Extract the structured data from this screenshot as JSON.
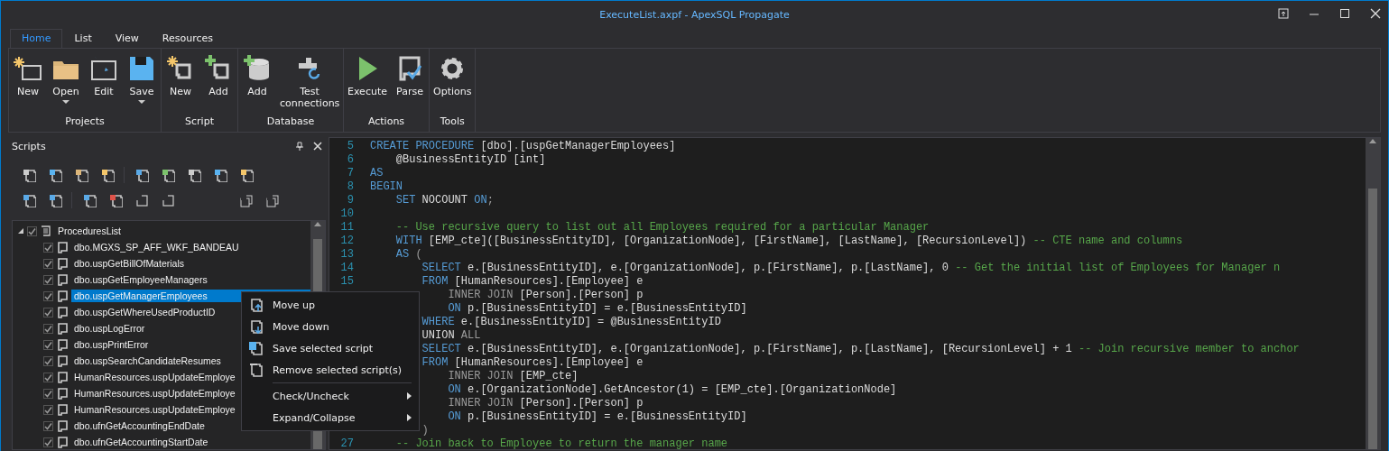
{
  "window": {
    "title": "ExecuteList.axpf - ApexSQL Propagate"
  },
  "ribbon": {
    "tabs": [
      {
        "label": "Home",
        "selected": true
      },
      {
        "label": "List",
        "selected": false
      },
      {
        "label": "View",
        "selected": false
      },
      {
        "label": "Resources",
        "selected": false
      }
    ],
    "groups": [
      {
        "label": "Projects",
        "buttons": [
          {
            "label": "New",
            "dropdown": false
          },
          {
            "label": "Open",
            "dropdown": true
          },
          {
            "label": "Edit",
            "dropdown": false
          },
          {
            "label": "Save",
            "dropdown": true
          }
        ]
      },
      {
        "label": "Script",
        "buttons": [
          {
            "label": "New",
            "dropdown": false
          },
          {
            "label": "Add",
            "dropdown": false
          }
        ]
      },
      {
        "label": "Database",
        "buttons": [
          {
            "label": "Add",
            "dropdown": false
          },
          {
            "label": "Test connections",
            "dropdown": false
          }
        ]
      },
      {
        "label": "Actions",
        "buttons": [
          {
            "label": "Execute",
            "dropdown": false
          },
          {
            "label": "Parse",
            "dropdown": false
          }
        ]
      },
      {
        "label": "Tools",
        "buttons": [
          {
            "label": "Options",
            "dropdown": false
          }
        ]
      }
    ]
  },
  "scripts_panel": {
    "title": "Scripts",
    "tree": [
      {
        "label": "ProceduresList",
        "checked": true,
        "expanded": true,
        "selected": false,
        "children": [
          {
            "label": "dbo.MGXS_SP_AFF_WKF_BANDEAU",
            "checked": true,
            "selected": false
          },
          {
            "label": "dbo.uspGetBillOfMaterials",
            "checked": true,
            "selected": false
          },
          {
            "label": "dbo.uspGetEmployeeManagers",
            "checked": true,
            "selected": false
          },
          {
            "label": "dbo.uspGetManagerEmployees",
            "checked": true,
            "selected": true
          },
          {
            "label": "dbo.uspGetWhereUsedProductID",
            "checked": true,
            "selected": false
          },
          {
            "label": "dbo.uspLogError",
            "checked": true,
            "selected": false
          },
          {
            "label": "dbo.uspPrintError",
            "checked": true,
            "selected": false
          },
          {
            "label": "dbo.uspSearchCandidateResumes",
            "checked": true,
            "selected": false
          },
          {
            "label": "HumanResources.uspUpdateEmploye",
            "checked": true,
            "selected": false
          },
          {
            "label": "HumanResources.uspUpdateEmploye",
            "checked": true,
            "selected": false
          },
          {
            "label": "HumanResources.uspUpdateEmploye",
            "checked": true,
            "selected": false
          },
          {
            "label": "dbo.ufnGetAccountingEndDate",
            "checked": true,
            "selected": false
          },
          {
            "label": "dbo.ufnGetAccountingStartDate",
            "checked": true,
            "selected": false
          }
        ]
      }
    ]
  },
  "context_menu": {
    "items": [
      {
        "kind": "item",
        "label": "Move up"
      },
      {
        "kind": "item",
        "label": "Move down"
      },
      {
        "kind": "item",
        "label": "Save selected script"
      },
      {
        "kind": "item",
        "label": "Remove selected script(s)"
      },
      {
        "kind": "separator"
      },
      {
        "kind": "submenu",
        "label": "Check/Uncheck"
      },
      {
        "kind": "submenu",
        "label": "Expand/Collapse"
      }
    ]
  },
  "editor": {
    "lines": [
      {
        "number": "5",
        "segments": [
          {
            "kind": "kw",
            "t": "CREATE PROCEDURE"
          },
          {
            "kind": "tx",
            "t": " [dbo]"
          },
          {
            "kind": "op",
            "t": "."
          },
          {
            "kind": "tx",
            "t": "[uspGetManagerEmployees]"
          }
        ]
      },
      {
        "number": "6",
        "segments": [
          {
            "kind": "tx",
            "t": "    @BusinessEntityID [int]"
          }
        ]
      },
      {
        "number": "7",
        "segments": [
          {
            "kind": "kw",
            "t": "AS"
          }
        ]
      },
      {
        "number": "8",
        "segments": [
          {
            "kind": "kw",
            "t": "BEGIN"
          }
        ]
      },
      {
        "number": "9",
        "segments": [
          {
            "kind": "kw",
            "t": "    SET"
          },
          {
            "kind": "tx",
            "t": " NOCOUNT "
          },
          {
            "kind": "kw",
            "t": "ON"
          },
          {
            "kind": "op",
            "t": ";"
          }
        ]
      },
      {
        "number": "10"
      },
      {
        "number": "11",
        "segments": [
          {
            "kind": "cm",
            "t": "    -- Use recursive query to list out all Employees required for a particular Manager"
          }
        ]
      },
      {
        "number": "12",
        "segments": [
          {
            "kind": "kw",
            "t": "    WITH"
          },
          {
            "kind": "tx",
            "t": " [EMP_cte]([BusinessEntityID], [OrganizationNode], [FirstName], [LastName], [RecursionLevel]) "
          },
          {
            "kind": "cm",
            "t": "-- CTE name and columns"
          }
        ]
      },
      {
        "number": "13",
        "segments": [
          {
            "kind": "kw",
            "t": "    AS"
          },
          {
            "kind": "op",
            "t": " ("
          }
        ]
      },
      {
        "number": "14",
        "segments": [
          {
            "kind": "kw",
            "t": "        SELECT"
          },
          {
            "kind": "tx",
            "t": " e.[BusinessEntityID], e.[OrganizationNode], p.[FirstName], p.[LastName], 0 "
          },
          {
            "kind": "cm",
            "t": "-- Get the initial list of Employees for Manager n"
          }
        ]
      },
      {
        "number": "15",
        "segments": [
          {
            "kind": "kw",
            "t": "        FROM"
          },
          {
            "kind": "tx",
            "t": " [HumanResources].[Employee] e"
          }
        ]
      },
      {
        "segments": [
          {
            "kind": "op",
            "t": "            INNER JOIN"
          },
          {
            "kind": "tx",
            "t": " [Person].[Person] p"
          }
        ]
      },
      {
        "segments": [
          {
            "kind": "kw",
            "t": "            ON"
          },
          {
            "kind": "tx",
            "t": " p.[BusinessEntityID] = e.[BusinessEntityID]"
          }
        ]
      },
      {
        "segments": [
          {
            "kind": "kw",
            "t": "        WHERE"
          },
          {
            "kind": "tx",
            "t": " e.[BusinessEntityID] = @BusinessEntityID"
          }
        ]
      },
      {
        "segments": [
          {
            "kind": "tx",
            "t": "        UNION"
          },
          {
            "kind": "op",
            "t": " ALL"
          }
        ]
      },
      {
        "segments": [
          {
            "kind": "kw",
            "t": "        SELECT"
          },
          {
            "kind": "tx",
            "t": " e.[BusinessEntityID], e.[OrganizationNode], p.[FirstName], p.[LastName], [RecursionLevel] + 1 "
          },
          {
            "kind": "cm",
            "t": "-- Join recursive member to anchor"
          }
        ]
      },
      {
        "segments": [
          {
            "kind": "kw",
            "t": "        FROM"
          },
          {
            "kind": "tx",
            "t": " [HumanResources].[Employee] e"
          }
        ]
      },
      {
        "segments": [
          {
            "kind": "op",
            "t": "            INNER JOIN"
          },
          {
            "kind": "tx",
            "t": " [EMP_cte]"
          }
        ]
      },
      {
        "segments": [
          {
            "kind": "kw",
            "t": "            ON"
          },
          {
            "kind": "tx",
            "t": " e.[OrganizationNode].GetAncestor(1) = [EMP_cte].[OrganizationNode]"
          }
        ]
      },
      {
        "segments": [
          {
            "kind": "op",
            "t": "            INNER JOIN"
          },
          {
            "kind": "tx",
            "t": " [Person].[Person] p"
          }
        ]
      },
      {
        "segments": [
          {
            "kind": "kw",
            "t": "            ON"
          },
          {
            "kind": "tx",
            "t": " p.[BusinessEntityID] = e.[BusinessEntityID]"
          }
        ]
      },
      {
        "segments": [
          {
            "kind": "op",
            "t": "        )"
          }
        ]
      },
      {
        "number": "27",
        "segments": [
          {
            "kind": "cm",
            "t": "    -- Join back to Employee to return the manager name"
          }
        ]
      }
    ]
  }
}
